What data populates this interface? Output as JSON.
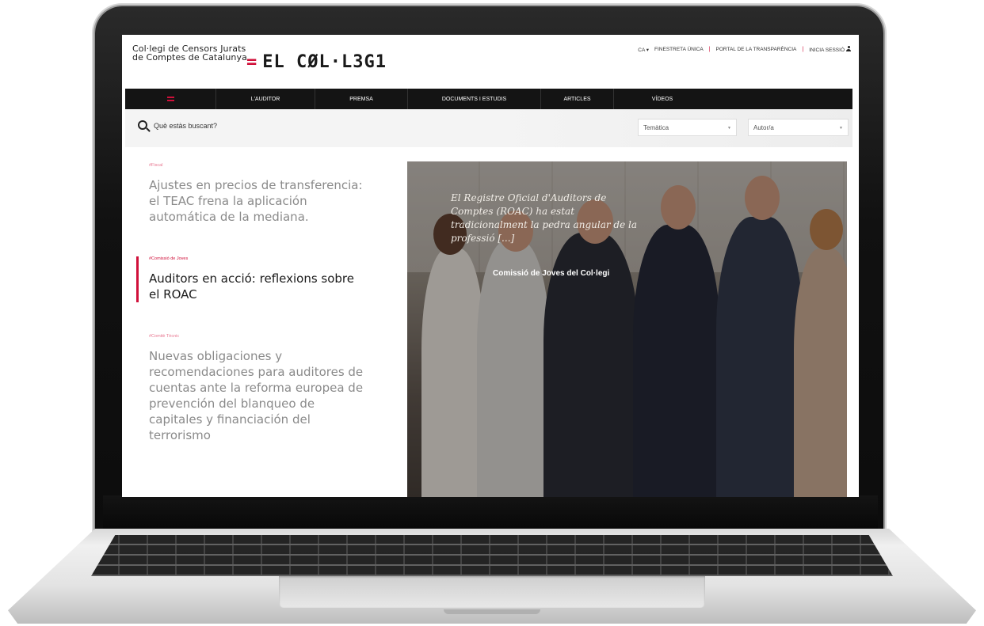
{
  "header": {
    "org_line1": "Col·legi de Censors Jurats",
    "org_line2": "de Comptes de Catalunya",
    "brand_mark": "=",
    "brand_text": "EL CØL·L3G1",
    "top_links": {
      "language": "CA ▾",
      "finestreta": "FINESTRETA ÚNICA",
      "portal": "PORTAL DE LA TRANSPARÈNCIA",
      "login": "INICIA SESSIÓ"
    }
  },
  "nav": {
    "items": [
      "L'AUDITOR",
      "PREMSA",
      "DOCUMENTS I ESTUDIS",
      "ARTICLES",
      "VÍDEOS"
    ]
  },
  "search": {
    "placeholder": "Què estàs buscant?",
    "filter_tematica": "Temàtica",
    "filter_autor": "Autor/a"
  },
  "articles": [
    {
      "tag": "#Fiscal",
      "title": "Ajustes en precios de transferencia: el TEAC frena la aplicación automática de la mediana."
    },
    {
      "tag": "#Comissió de Joves",
      "title": "Auditors en acció: reflexions sobre el ROAC"
    },
    {
      "tag": "#Comitè Tècnic",
      "title": "Nuevas obligaciones y recomendaciones para auditores de cuentas ante la reforma europea de prevención del blanqueo de capitales y financiación del terrorismo"
    }
  ],
  "hero": {
    "quote": "El Registre Oficial d'Auditors de Comptes (ROAC) ha estat tradicionalment la pedra angular de la professió [...]",
    "caption": "Comissió de Joves del Col·legi"
  },
  "colors": {
    "accent": "#d0103a",
    "nav_bg": "#141414"
  }
}
